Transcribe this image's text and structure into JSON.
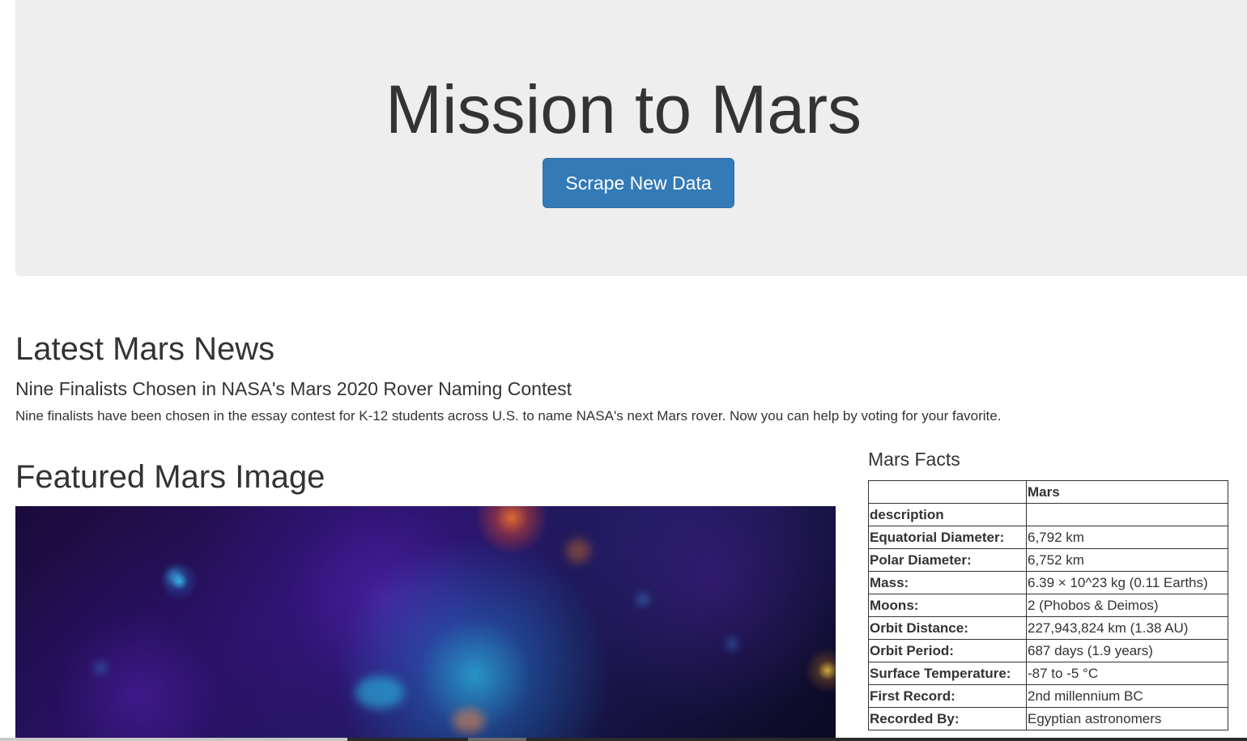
{
  "header": {
    "title": "Mission to Mars",
    "scrape_button_label": "Scrape New Data"
  },
  "news": {
    "heading": "Latest Mars News",
    "title": "Nine Finalists Chosen in NASA's Mars 2020 Rover Naming Contest",
    "paragraph": "Nine finalists have been chosen in the essay contest for K-12 students across U.S. to name NASA's next Mars rover. Now you can help by voting for your favorite."
  },
  "featured_image": {
    "heading": "Featured Mars Image",
    "icon": "space-nebula-image"
  },
  "facts": {
    "heading": "Mars Facts",
    "column_header": "Mars",
    "index_header": "description",
    "rows": [
      {
        "label": "Equatorial Diameter:",
        "value": "6,792 km"
      },
      {
        "label": "Polar Diameter:",
        "value": "6,752 km"
      },
      {
        "label": "Mass:",
        "value": "6.39 × 10^23 kg (0.11 Earths)"
      },
      {
        "label": "Moons:",
        "value": "2 (Phobos & Deimos)"
      },
      {
        "label": "Orbit Distance:",
        "value": "227,943,824 km (1.38 AU)"
      },
      {
        "label": "Orbit Period:",
        "value": "687 days (1.9 years)"
      },
      {
        "label": "Surface Temperature:",
        "value": "-87 to -5 °C"
      },
      {
        "label": "First Record:",
        "value": "2nd millennium BC"
      },
      {
        "label": "Recorded By:",
        "value": "Egyptian astronomers"
      }
    ]
  },
  "colors": {
    "jumbotron_bg": "#eeeeee",
    "primary_button": "#337ab7",
    "text": "#333333"
  }
}
